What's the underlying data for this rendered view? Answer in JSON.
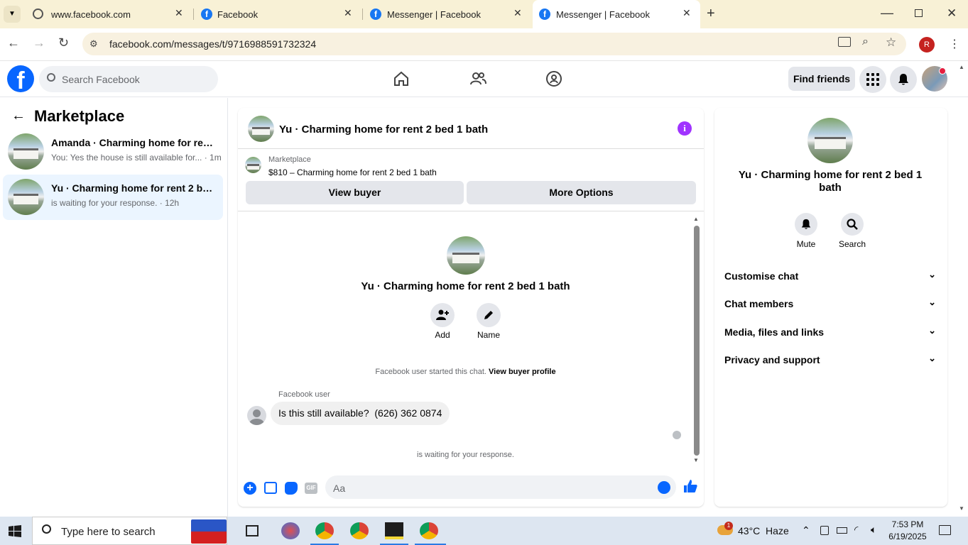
{
  "browser": {
    "tabs": [
      {
        "title": "www.facebook.com",
        "active": false
      },
      {
        "title": "Facebook",
        "active": false
      },
      {
        "title": "Messenger | Facebook",
        "active": false
      },
      {
        "title": "Messenger | Facebook",
        "active": true
      }
    ],
    "url": "facebook.com/messages/t/9716988591732324",
    "profile_initial": "R"
  },
  "fb_header": {
    "search_placeholder": "Search Facebook",
    "find_friends": "Find friends",
    "logo_letter": "f"
  },
  "left_panel": {
    "title": "Marketplace",
    "conversations": [
      {
        "name": "Amanda · Charming home for rent...",
        "preview": "You: Yes the house is still available for... · 1m",
        "selected": false
      },
      {
        "name": "Yu · Charming home for rent 2 bed...",
        "preview": "is waiting for your response. · 12h",
        "selected": true
      }
    ]
  },
  "chat": {
    "title": "Yu · Charming home for rent 2 bed 1 bath",
    "listing_source": "Marketplace",
    "listing": "$810 – Charming home for rent 2 bed 1 bath",
    "view_buyer": "View buyer",
    "more_options": "More Options",
    "profile_name": "Yu · Charming home for rent 2 bed 1 bath",
    "add_label": "Add",
    "name_label": "Name",
    "started_text": "Facebook user started this chat.",
    "view_buyer_profile": "View buyer profile",
    "sender": "Facebook user",
    "message": "Is this still available?  (626) 362 0874",
    "waiting": "is waiting for your response.",
    "input_placeholder": "Aa",
    "gif_label": "GIF"
  },
  "right_panel": {
    "name": "Yu · Charming home for rent 2 bed 1 bath",
    "mute": "Mute",
    "search": "Search",
    "sections": [
      "Customise chat",
      "Chat members",
      "Media, files and links",
      "Privacy and support"
    ]
  },
  "taskbar": {
    "search_placeholder": "Type here to search",
    "weather": "43°C  Haze",
    "time": "7:53 PM",
    "date": "6/19/2025",
    "weather_badge": "1"
  },
  "colors": {
    "fb_blue": "#0866ff",
    "messenger_purple": "#a033ff",
    "selected_bg": "#ebf5ff",
    "tabbar_bg": "#f8f1d6"
  }
}
